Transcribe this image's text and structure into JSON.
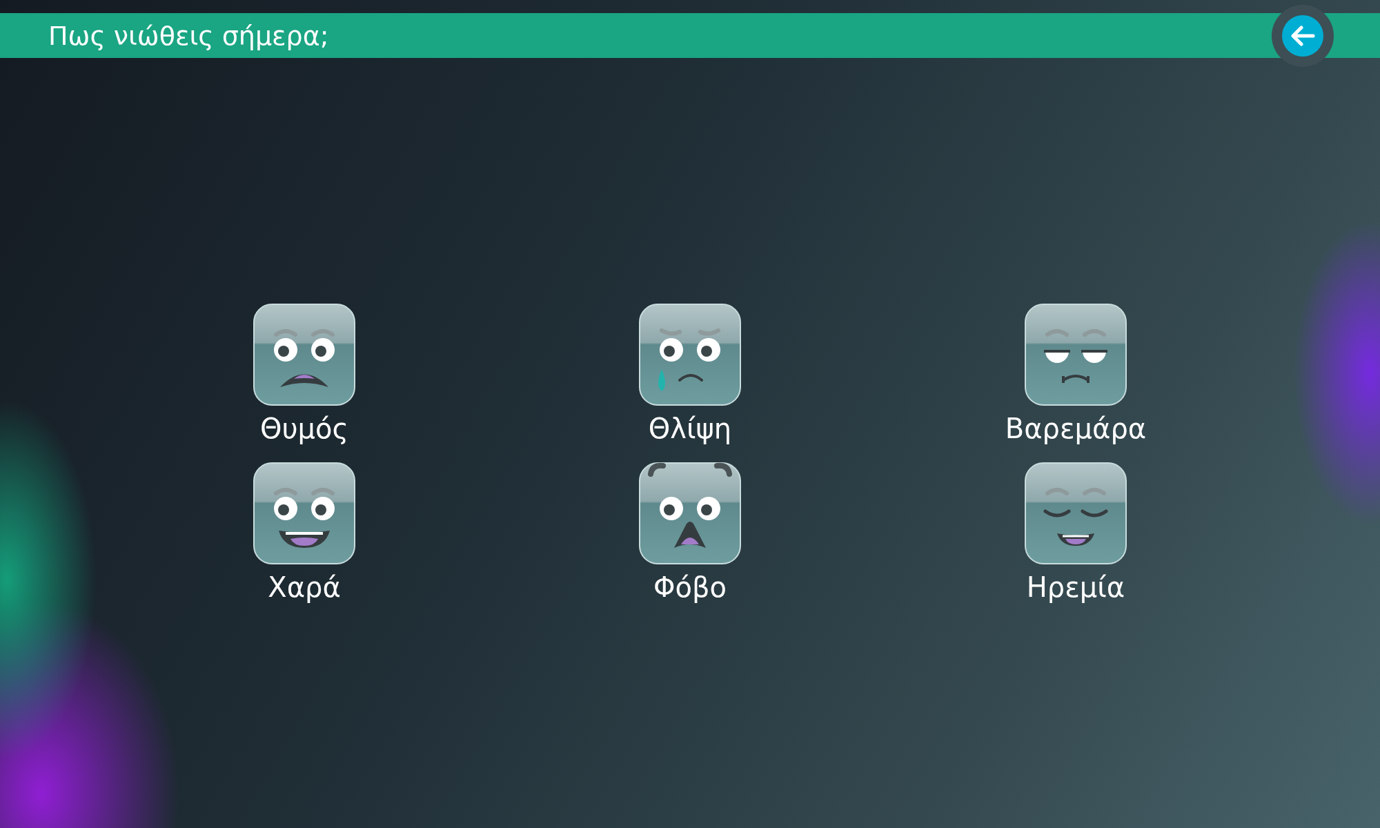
{
  "header": {
    "title": "Πως νιώθεις σήμερα;"
  },
  "moods": [
    {
      "kind": "angry",
      "label": "Θυμός"
    },
    {
      "kind": "sad",
      "label": "Θλίψη"
    },
    {
      "kind": "bored",
      "label": "Βαρεμάρα"
    },
    {
      "kind": "happy",
      "label": "Χαρά"
    },
    {
      "kind": "scared",
      "label": "Φόβο"
    },
    {
      "kind": "calm",
      "label": "Ηρεμία"
    }
  ]
}
